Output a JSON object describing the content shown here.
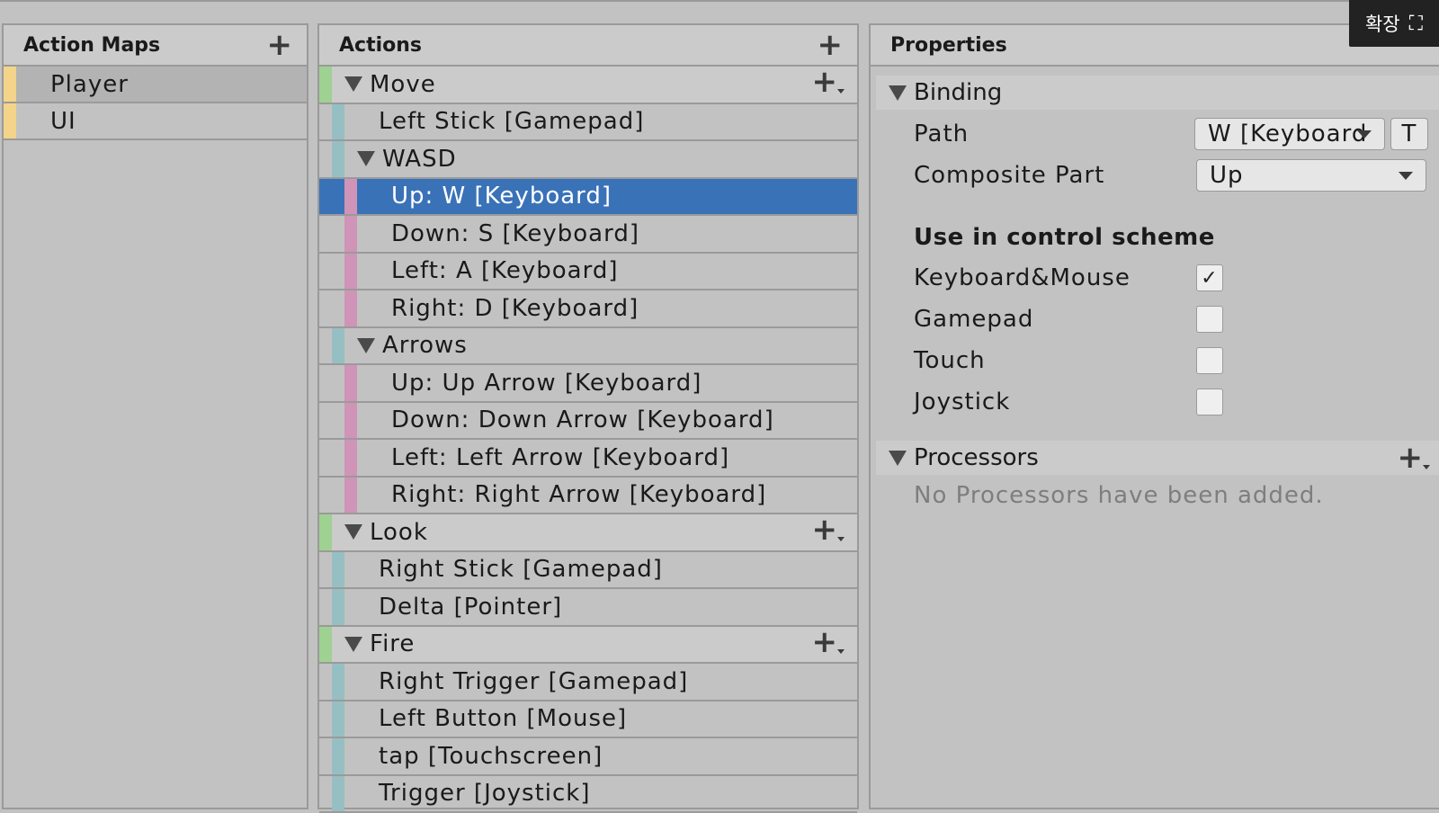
{
  "overlay": {
    "expand_label": "확장",
    "expand_icon": "⛶"
  },
  "action_maps": {
    "title": "Action Maps",
    "items": [
      {
        "label": "Player",
        "selected": true
      },
      {
        "label": "UI",
        "selected": false
      }
    ]
  },
  "actions": {
    "title": "Actions",
    "rows": [
      {
        "label": "Move",
        "type": "action"
      },
      {
        "label": "Left Stick [Gamepad]",
        "type": "binding"
      },
      {
        "label": "WASD",
        "type": "composite"
      },
      {
        "label": "Up: W [Keyboard]",
        "type": "part",
        "selected": true
      },
      {
        "label": "Down: S [Keyboard]",
        "type": "part"
      },
      {
        "label": "Left: A [Keyboard]",
        "type": "part"
      },
      {
        "label": "Right: D [Keyboard]",
        "type": "part"
      },
      {
        "label": "Arrows",
        "type": "composite"
      },
      {
        "label": "Up: Up Arrow [Keyboard]",
        "type": "part"
      },
      {
        "label": "Down: Down Arrow [Keyboard]",
        "type": "part"
      },
      {
        "label": "Left: Left Arrow [Keyboard]",
        "type": "part"
      },
      {
        "label": "Right: Right Arrow [Keyboard]",
        "type": "part"
      },
      {
        "label": "Look",
        "type": "action"
      },
      {
        "label": "Right Stick [Gamepad]",
        "type": "binding"
      },
      {
        "label": "Delta [Pointer]",
        "type": "binding"
      },
      {
        "label": "Fire",
        "type": "action"
      },
      {
        "label": "Right Trigger [Gamepad]",
        "type": "binding"
      },
      {
        "label": "Left Button [Mouse]",
        "type": "binding"
      },
      {
        "label": "tap [Touchscreen]",
        "type": "binding"
      },
      {
        "label": "Trigger [Joystick]",
        "type": "binding"
      }
    ]
  },
  "properties": {
    "title": "Properties",
    "binding_section": "Binding",
    "path_label": "Path",
    "path_value": "W [Keyboard",
    "t_button": "T",
    "composite_label": "Composite Part",
    "composite_value": "Up",
    "control_scheme_title": "Use in control scheme",
    "schemes": [
      {
        "label": "Keyboard&Mouse",
        "checked": true
      },
      {
        "label": "Gamepad",
        "checked": false
      },
      {
        "label": "Touch",
        "checked": false
      },
      {
        "label": "Joystick",
        "checked": false
      }
    ],
    "processors_section": "Processors",
    "processors_empty": "No Processors have been added."
  },
  "colors": {
    "map_bar": "#f4d38a",
    "action_bar": "#9fd192",
    "binding_bar": "#96bfc3",
    "part_bar": "#cf94b8",
    "selection": "#3a72b8"
  }
}
